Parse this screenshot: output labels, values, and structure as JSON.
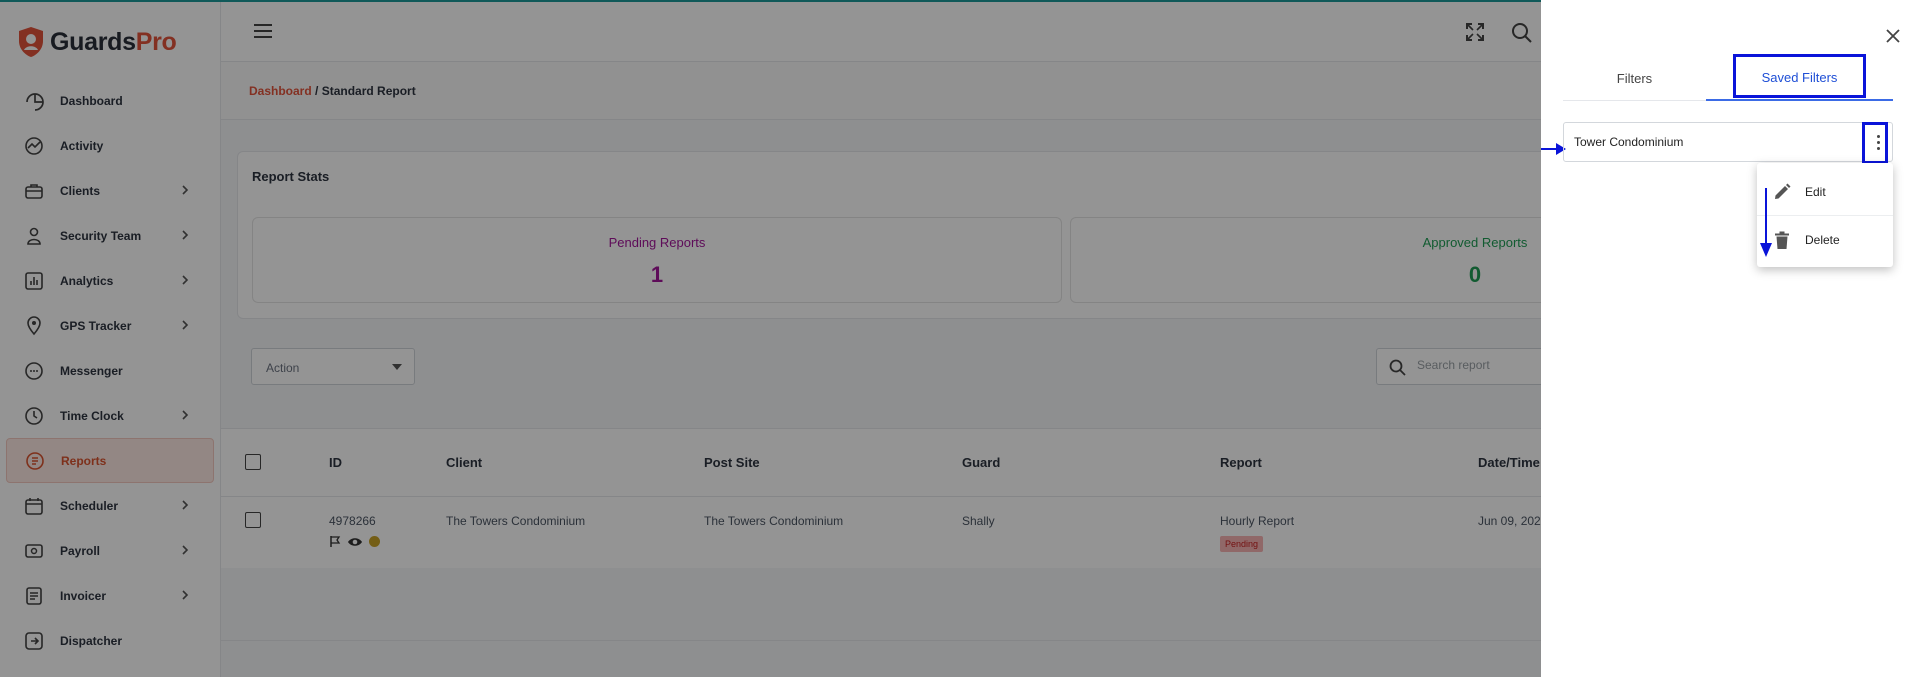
{
  "app": {
    "brand_main": "Guards",
    "brand_accent": "Pro",
    "accent_color": "#e2533b"
  },
  "sidebar": {
    "items": [
      {
        "label": "Dashboard",
        "icon": "dashboard-icon",
        "has_children": false
      },
      {
        "label": "Activity",
        "icon": "activity-icon",
        "has_children": false
      },
      {
        "label": "Clients",
        "icon": "briefcase-icon",
        "has_children": true
      },
      {
        "label": "Security Team",
        "icon": "guard-icon",
        "has_children": true
      },
      {
        "label": "Analytics",
        "icon": "analytics-icon",
        "has_children": true
      },
      {
        "label": "GPS Tracker",
        "icon": "map-pin-icon",
        "has_children": true
      },
      {
        "label": "Messenger",
        "icon": "chat-icon",
        "has_children": false
      },
      {
        "label": "Time Clock",
        "icon": "clock-icon",
        "has_children": true
      },
      {
        "label": "Reports",
        "icon": "report-icon",
        "has_children": false,
        "active": true
      },
      {
        "label": "Scheduler",
        "icon": "calendar-icon",
        "has_children": true
      },
      {
        "label": "Payroll",
        "icon": "payroll-icon",
        "has_children": true
      },
      {
        "label": "Invoicer",
        "icon": "invoice-icon",
        "has_children": true
      },
      {
        "label": "Dispatcher",
        "icon": "dispatch-icon",
        "has_children": false
      }
    ]
  },
  "breadcrumb": {
    "parent": "Dashboard",
    "separator": " / ",
    "current": "Standard Report"
  },
  "stats": {
    "title": "Report Stats",
    "pending": {
      "label": "Pending Reports",
      "value": "1",
      "color": "#a3159a"
    },
    "approved": {
      "label": "Approved Reports",
      "value": "0",
      "color": "#1f9d55"
    }
  },
  "toolbar": {
    "action_label": "Action",
    "search_placeholder": "Search report"
  },
  "table": {
    "columns": [
      "ID",
      "Client",
      "Post Site",
      "Guard",
      "Report",
      "Date/Time"
    ],
    "rows": [
      {
        "id": "4978266",
        "client": "The Towers Condominium",
        "post_site": "The Towers Condominium",
        "guard": "Shally",
        "report": "Hourly Report",
        "status": "Pending",
        "datetime": "Jun 09, 202"
      }
    ]
  },
  "drawer": {
    "tabs": {
      "filters": "Filters",
      "saved_filters": "Saved Filters"
    },
    "saved_filter_name": "Tower Condominium",
    "menu": {
      "edit": "Edit",
      "delete": "Delete"
    }
  }
}
